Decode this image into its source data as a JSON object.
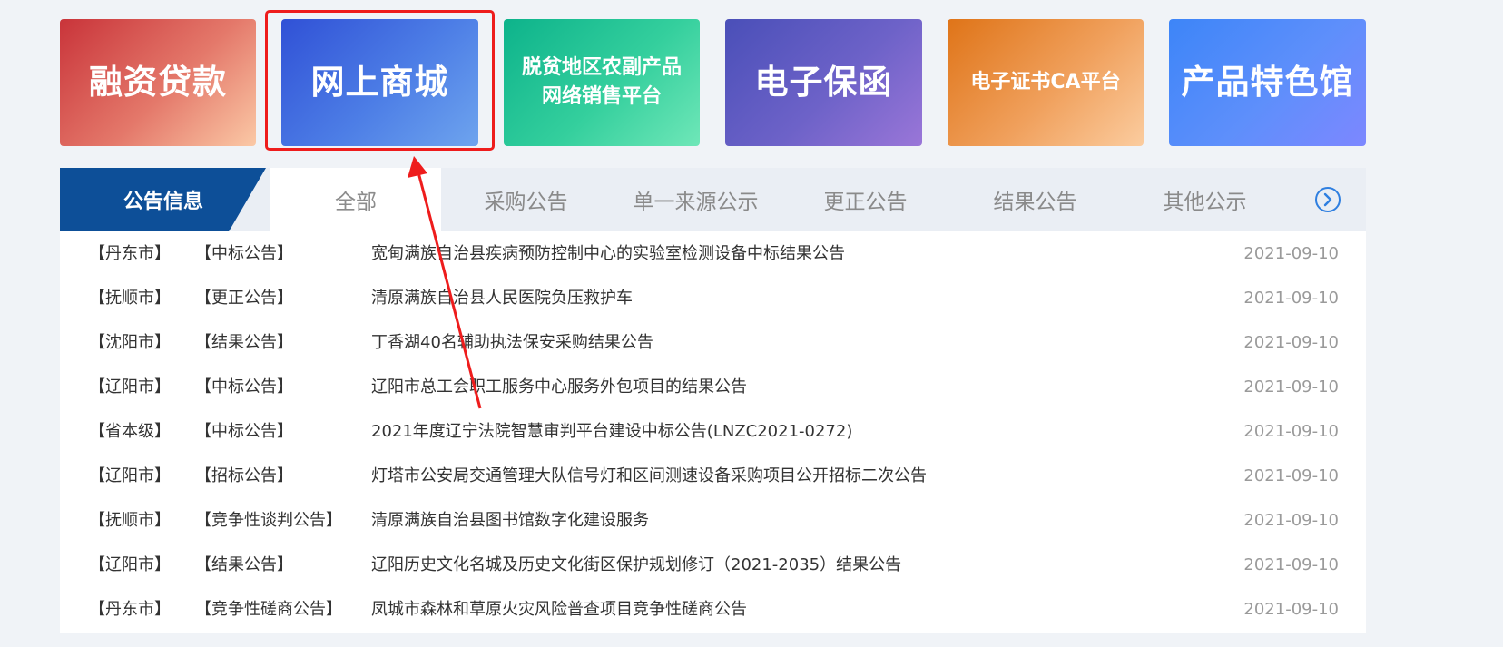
{
  "tiles": [
    {
      "label": "融资贷款"
    },
    {
      "label": "网上商城"
    },
    {
      "label": "脱贫地区农副产品网络销售平台"
    },
    {
      "label": "电子保函"
    },
    {
      "label": "电子证书CA平台"
    },
    {
      "label": "产品特色馆"
    }
  ],
  "notice": {
    "section_title": "公告信息",
    "tabs": [
      "全部",
      "采购公告",
      "单一来源公示",
      "更正公告",
      "结果公告",
      "其他公示"
    ],
    "active_tab": "全部",
    "next_icon": "chevron-right-circle-icon",
    "rows": [
      {
        "city": "【丹东市】",
        "type": "【中标公告】",
        "title": "宽甸满族自治县疾病预防控制中心的实验室检测设备中标结果公告",
        "date": "2021-09-10"
      },
      {
        "city": "【抚顺市】",
        "type": "【更正公告】",
        "title": "清原满族自治县人民医院负压救护车",
        "date": "2021-09-10"
      },
      {
        "city": "【沈阳市】",
        "type": "【结果公告】",
        "title": "丁香湖40名辅助执法保安采购结果公告",
        "date": "2021-09-10"
      },
      {
        "city": "【辽阳市】",
        "type": "【中标公告】",
        "title": "辽阳市总工会职工服务中心服务外包项目的结果公告",
        "date": "2021-09-10"
      },
      {
        "city": "【省本级】",
        "type": "【中标公告】",
        "title": "2021年度辽宁法院智慧审判平台建设中标公告(LNZC2021-0272)",
        "date": "2021-09-10"
      },
      {
        "city": "【辽阳市】",
        "type": "【招标公告】",
        "title": "灯塔市公安局交通管理大队信号灯和区间测速设备采购项目公开招标二次公告",
        "date": "2021-09-10"
      },
      {
        "city": "【抚顺市】",
        "type": "【竞争性谈判公告】",
        "title": "清原满族自治县图书馆数字化建设服务",
        "date": "2021-09-10"
      },
      {
        "city": "【辽阳市】",
        "type": "【结果公告】",
        "title": "辽阳历史文化名城及历史文化街区保护规划修订（2021-2035）结果公告",
        "date": "2021-09-10"
      },
      {
        "city": "【丹东市】",
        "type": "【竞争性磋商公告】",
        "title": "凤城市森林和草原火灾风险普查项目竞争性磋商公告",
        "date": "2021-09-10"
      }
    ]
  },
  "annotation": {
    "highlight_color": "#ee1c1c"
  }
}
